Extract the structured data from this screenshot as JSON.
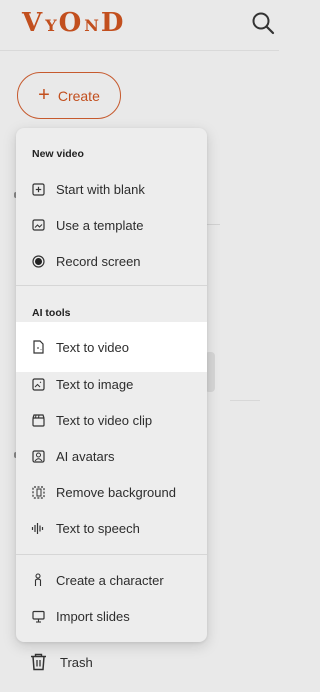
{
  "header": {
    "logo_text": "VYOND",
    "search_icon": "search-icon"
  },
  "create_button": {
    "label": "Create",
    "icon": "plus-icon"
  },
  "menu": {
    "section_new_video": "New video",
    "new_video_items": [
      {
        "label": "Start with blank",
        "icon": "plus-square-icon"
      },
      {
        "label": "Use a template",
        "icon": "image-frame-icon"
      },
      {
        "label": "Record screen",
        "icon": "record-icon"
      }
    ],
    "section_ai_tools": "AI tools",
    "ai_items": [
      {
        "label": "Text to video",
        "icon": "doc-sparkle-icon",
        "highlighted": true
      },
      {
        "label": "Text to image",
        "icon": "image-sparkle-icon"
      },
      {
        "label": "Text to video clip",
        "icon": "clapper-icon"
      },
      {
        "label": "AI avatars",
        "icon": "avatar-icon"
      },
      {
        "label": "Remove background",
        "icon": "remove-bg-icon"
      },
      {
        "label": "Text to speech",
        "icon": "waveform-icon"
      }
    ],
    "other_items": [
      {
        "label": "Create a character",
        "icon": "character-icon"
      },
      {
        "label": "Import slides",
        "icon": "presentation-icon"
      }
    ]
  },
  "sidebar": {
    "trash_label": "Trash",
    "trash_icon": "trash-icon"
  },
  "colors": {
    "accent": "#c24f1e",
    "background": "#e9e9e9",
    "menu_bg": "#ededed",
    "highlight": "#ffffff"
  }
}
